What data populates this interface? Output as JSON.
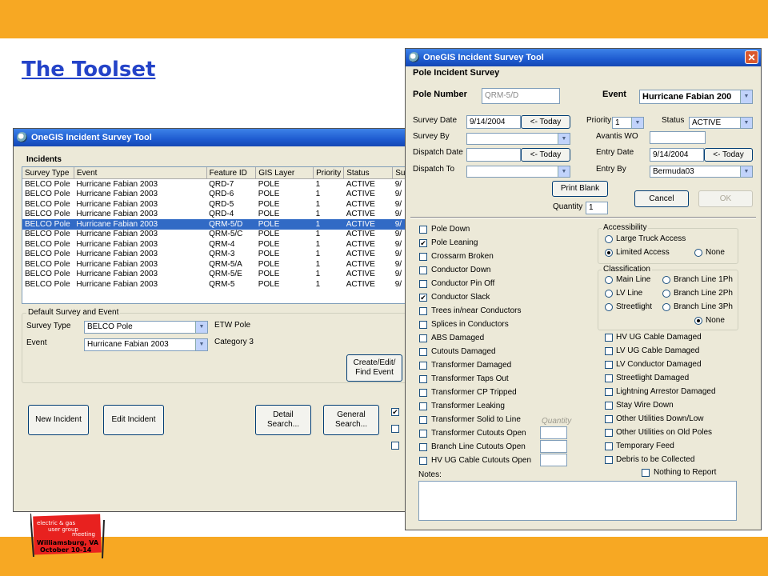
{
  "slide": {
    "title": "The Toolset"
  },
  "back_window": {
    "title": "OneGIS Incident Survey Tool",
    "incidents_label": "Incidents",
    "columns": [
      "Survey Type",
      "Event",
      "Feature ID",
      "GIS Layer",
      "Priority",
      "Status",
      "Sur"
    ],
    "rows": [
      [
        "BELCO Pole",
        "Hurricane Fabian 2003",
        "QRD-7",
        "POLE",
        "1",
        "ACTIVE",
        "9/"
      ],
      [
        "BELCO Pole",
        "Hurricane Fabian 2003",
        "QRD-6",
        "POLE",
        "1",
        "ACTIVE",
        "9/"
      ],
      [
        "BELCO Pole",
        "Hurricane Fabian 2003",
        "QRD-5",
        "POLE",
        "1",
        "ACTIVE",
        "9/"
      ],
      [
        "BELCO Pole",
        "Hurricane Fabian 2003",
        "QRD-4",
        "POLE",
        "1",
        "ACTIVE",
        "9/"
      ],
      [
        "BELCO Pole",
        "Hurricane Fabian 2003",
        "QRM-5/D",
        "POLE",
        "1",
        "ACTIVE",
        "9/"
      ],
      [
        "BELCO Pole",
        "Hurricane Fabian 2003",
        "QRM-5/C",
        "POLE",
        "1",
        "ACTIVE",
        "9/"
      ],
      [
        "BELCO Pole",
        "Hurricane Fabian 2003",
        "QRM-4",
        "POLE",
        "1",
        "ACTIVE",
        "9/"
      ],
      [
        "BELCO Pole",
        "Hurricane Fabian 2003",
        "QRM-3",
        "POLE",
        "1",
        "ACTIVE",
        "9/"
      ],
      [
        "BELCO Pole",
        "Hurricane Fabian 2003",
        "QRM-5/A",
        "POLE",
        "1",
        "ACTIVE",
        "9/"
      ],
      [
        "BELCO Pole",
        "Hurricane Fabian 2003",
        "QRM-5/E",
        "POLE",
        "1",
        "ACTIVE",
        "9/"
      ],
      [
        "BELCO Pole",
        "Hurricane Fabian 2003",
        "QRM-5",
        "POLE",
        "1",
        "ACTIVE",
        "9/"
      ]
    ],
    "selected_row": 4,
    "default_group": "Default Survey and Event",
    "survey_type_label": "Survey Type",
    "survey_type_value": "BELCO Pole",
    "event_label": "Event",
    "event_value": "Hurricane Fabian 2003",
    "etw_text": "ETW Pole",
    "category_text": "Category 3",
    "create_button": "Create/Edit/ Find Event",
    "new_incident": "New Incident",
    "edit_incident": "Edit Incident",
    "detail_search": "Detail Search...",
    "general_search": "General Search..."
  },
  "front_window": {
    "title": "OneGIS Incident Survey Tool",
    "header": "Pole Incident Survey",
    "pole_number_label": "Pole Number",
    "pole_number_value": "QRM-5/D",
    "event_label": "Event",
    "event_value": "Hurricane Fabian 200",
    "survey_date_label": "Survey Date",
    "survey_date_value": "9/14/2004",
    "today_label": "<- Today",
    "priority_label": "Priority",
    "priority_value": "1",
    "status_label": "Status",
    "status_value": "ACTIVE",
    "survey_by_label": "Survey By",
    "avantis_label": "Avantis WO",
    "dispatch_date_label": "Dispatch Date",
    "entry_date_label": "Entry Date",
    "entry_date_value": "9/14/2004",
    "dispatch_to_label": "Dispatch To",
    "entry_by_label": "Entry By",
    "entry_by_value": "Bermuda03",
    "print_blank": "Print Blank",
    "cancel": "Cancel",
    "ok": "OK",
    "quantity_label": "Quantity",
    "quantity_value": "1",
    "left_checks": [
      {
        "label": "Pole Down",
        "checked": false
      },
      {
        "label": "Pole Leaning",
        "checked": true
      },
      {
        "label": "Crossarm Broken",
        "checked": false
      },
      {
        "label": "Conductor Down",
        "checked": false
      },
      {
        "label": "Conductor Pin Off",
        "checked": false
      },
      {
        "label": "Conductor Slack",
        "checked": true
      },
      {
        "label": "Trees in/near Conductors",
        "checked": false
      },
      {
        "label": "Splices in Conductors",
        "checked": false
      },
      {
        "label": "ABS Damaged",
        "checked": false
      },
      {
        "label": "Cutouts Damaged",
        "checked": false
      },
      {
        "label": "Transformer Damaged",
        "checked": false
      },
      {
        "label": "Transformer Taps Out",
        "checked": false
      },
      {
        "label": "Transformer CP Tripped",
        "checked": false
      },
      {
        "label": "Transformer Leaking",
        "checked": false
      },
      {
        "label": "Transformer Solid to Line",
        "checked": false
      },
      {
        "label": "Transformer Cutouts Open",
        "checked": false
      },
      {
        "label": "Branch Line Cutouts Open",
        "checked": false
      },
      {
        "label": "HV UG Cable Cutouts Open",
        "checked": false
      }
    ],
    "quantity_caption": "Quantity",
    "accessibility": {
      "legend": "Accessibility",
      "large_truck": "Large Truck Access",
      "limited": "Limited Access",
      "none": "None"
    },
    "classification": {
      "legend": "Classification",
      "main_line": "Main Line",
      "lv_line": "LV Line",
      "streetlight": "Streetlight",
      "branch_1": "Branch Line 1Ph",
      "branch_2": "Branch Line 2Ph",
      "branch_3": "Branch Line 3Ph",
      "none": "None"
    },
    "right_checks": [
      "HV UG Cable Damaged",
      "LV UG Cable Damaged",
      "LV Conductor Damaged",
      "Streetlight Damaged",
      "Lightning Arrestor Damaged",
      "Stay Wire Down",
      "Other Utilities Down/Low",
      "Other Utilities on Old Poles",
      "Temporary Feed",
      "Debris to be Collected"
    ],
    "nothing_to_report": "Nothing to Report",
    "notes_label": "Notes:"
  },
  "logo": {
    "line1": "electric & gas",
    "line2": "user group",
    "line3": "meeting",
    "place": "Williamsburg, VA",
    "dates": "October 10-14"
  }
}
